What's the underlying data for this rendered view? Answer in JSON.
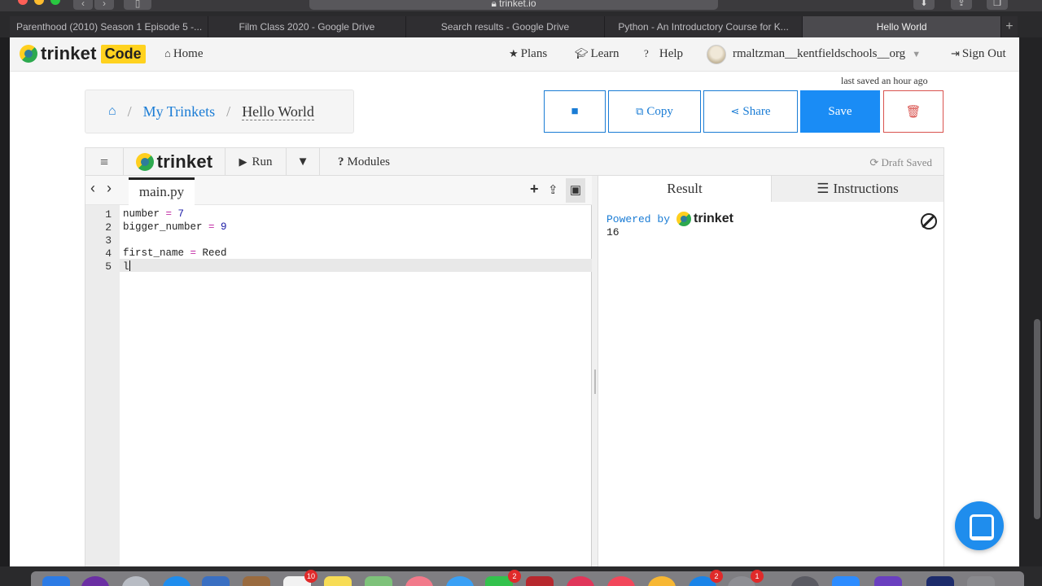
{
  "browser": {
    "url": "trinket.io",
    "tabs": [
      {
        "label": "Parenthood (2010) Season 1 Episode 5 -..."
      },
      {
        "label": "Film Class 2020 - Google Drive"
      },
      {
        "label": "Search results - Google Drive"
      },
      {
        "label": "Python - An Introductory Course for K..."
      },
      {
        "label": "Hello World"
      }
    ],
    "active_tab": 4
  },
  "navbar": {
    "logo_text": "trinket",
    "logo_badge": "Code",
    "home": "Home",
    "plans": "Plans",
    "learn": "Learn",
    "help": "Help",
    "username": "rmaltzman__kentfieldschools__org",
    "sign_out": "Sign Out"
  },
  "status": {
    "last_saved": "last saved an hour ago"
  },
  "breadcrumb": {
    "my_trinkets": "My Trinkets",
    "current": "Hello World"
  },
  "actions": {
    "copy": "Copy",
    "share": "Share",
    "save": "Save"
  },
  "toolbar": {
    "logo_text": "trinket",
    "run": "Run",
    "modules": "Modules",
    "draft": "Draft Saved"
  },
  "editor": {
    "file_name": "main.py",
    "line_numbers": [
      "1",
      "2",
      "3",
      "4",
      "5"
    ],
    "lines": [
      {
        "var": "number",
        "op": " = ",
        "val": "7"
      },
      {
        "var": "bigger_number",
        "op": " = ",
        "val": "9"
      },
      {
        "var": "",
        "op": "",
        "val": ""
      },
      {
        "var": "first_name",
        "op": " = ",
        "val": "Reed"
      },
      {
        "var": "l",
        "op": "",
        "val": ""
      }
    ]
  },
  "output": {
    "tab_result": "Result",
    "tab_instructions": "Instructions",
    "powered_by": "Powered by",
    "powered_logo": "trinket",
    "text": "16"
  },
  "dock": {
    "badges": [
      "10",
      "2",
      "2",
      "1"
    ]
  },
  "colors": {
    "accent": "#1a7cd5",
    "save": "#1a8cf5",
    "delete": "#d9534f",
    "badge": "#ffd21f"
  }
}
